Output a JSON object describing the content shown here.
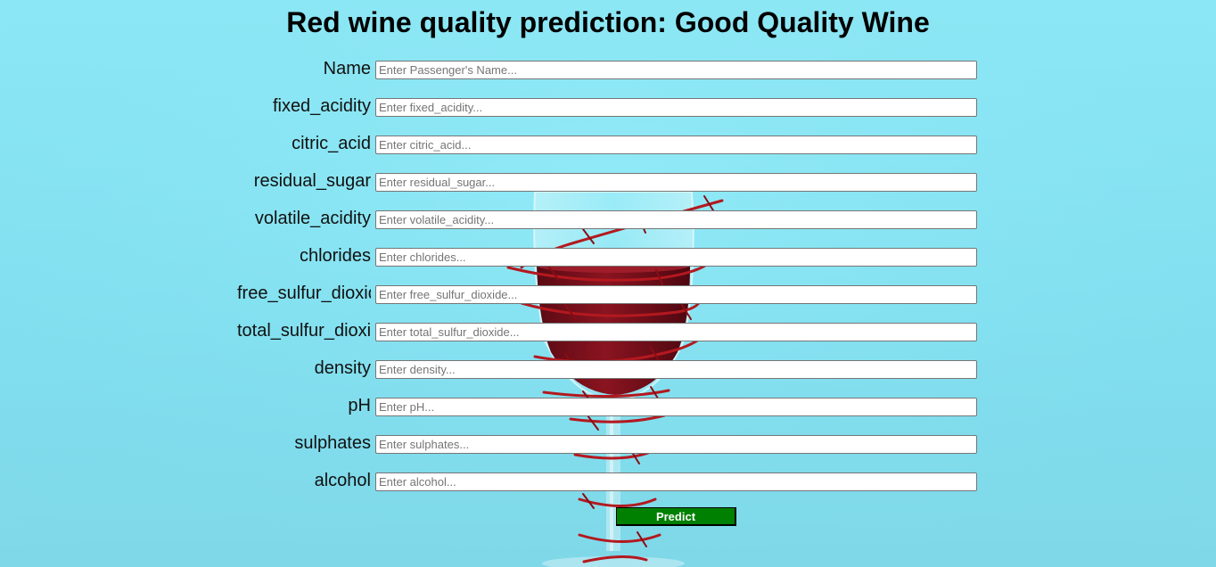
{
  "page": {
    "title": "Red wine quality prediction: Good Quality Wine"
  },
  "colors": {
    "background": "#8ee9f7",
    "button": "#008000",
    "wine": "#7a0f1c",
    "wire": "#b3191f"
  },
  "background_image": {
    "icon": "wine-glass-barbed-wire-illustration"
  },
  "form": {
    "fields": [
      {
        "label": "Name",
        "placeholder": "Enter Passenger's Name...",
        "value": ""
      },
      {
        "label": "fixed_acidity",
        "placeholder": "Enter fixed_acidity...",
        "value": ""
      },
      {
        "label": "citric_acid",
        "placeholder": "Enter citric_acid...",
        "value": ""
      },
      {
        "label": "residual_sugar",
        "placeholder": "Enter residual_sugar...",
        "value": ""
      },
      {
        "label": "volatile_acidity",
        "placeholder": "Enter volatile_acidity...",
        "value": ""
      },
      {
        "label": "chlorides",
        "placeholder": "Enter chlorides...",
        "value": ""
      },
      {
        "label": "free_sulfur_dioxide",
        "placeholder": "Enter free_sulfur_dioxide...",
        "value": ""
      },
      {
        "label": "total_sulfur_dioxide",
        "placeholder": "Enter total_sulfur_dioxide...",
        "value": ""
      },
      {
        "label": "density",
        "placeholder": "Enter density...",
        "value": ""
      },
      {
        "label": "pH",
        "placeholder": "Enter pH...",
        "value": ""
      },
      {
        "label": "sulphates",
        "placeholder": "Enter sulphates...",
        "value": ""
      },
      {
        "label": "alcohol",
        "placeholder": "Enter alcohol...",
        "value": ""
      }
    ],
    "submit_label": "Predict"
  }
}
